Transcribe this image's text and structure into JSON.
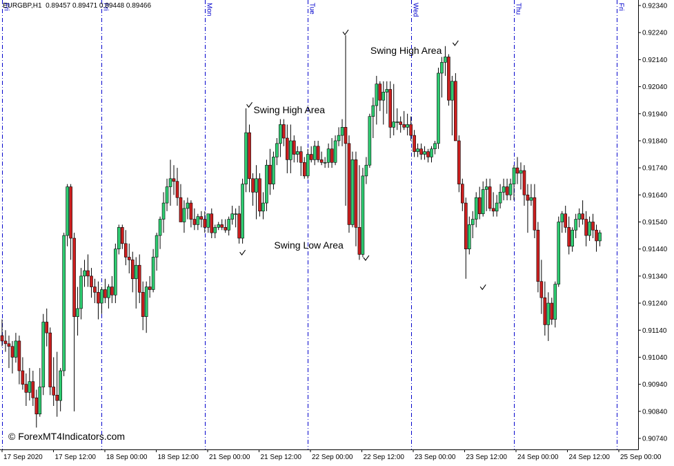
{
  "header": {
    "symbol": "EURGBP,H1",
    "ohlc": "0.89457 0.89471 0.89448 0.89466"
  },
  "watermark": "© ForexMT4Indicators.com",
  "colors": {
    "bull_candle": "#2ecc71",
    "bear_candle": "#cc1f1f",
    "wick": "#000000",
    "separator": "#0000cc",
    "axis": "#000000",
    "background": "#ffffff"
  },
  "chart_data": {
    "type": "candlestick",
    "symbol": "EURGBP",
    "timeframe": "H1",
    "grid": false,
    "y_ticks": [
      "0.92340",
      "0.92240",
      "0.92140",
      "0.92040",
      "0.91940",
      "0.91840",
      "0.91740",
      "0.91640",
      "0.91540",
      "0.91440",
      "0.91340",
      "0.91240",
      "0.91140",
      "0.91040",
      "0.90940",
      "0.90840",
      "0.90740"
    ],
    "ylim": [
      0.907,
      0.9236
    ],
    "x_ticks": [
      "17 Sep 2020",
      "17 Sep 12:00",
      "18 Sep 00:00",
      "18 Sep 12:00",
      "21 Sep 00:00",
      "21 Sep 12:00",
      "22 Sep 00:00",
      "22 Sep 12:00",
      "23 Sep 00:00",
      "23 Sep 12:00",
      "24 Sep 00:00",
      "24 Sep 12:00",
      "25 Sep 00:00"
    ],
    "day_separators": [
      {
        "label": "Fri",
        "index": 0
      },
      {
        "label": "Fri",
        "index": 29
      },
      {
        "label": "Mon",
        "index": 59
      },
      {
        "label": "Tue",
        "index": 89
      },
      {
        "label": "Wed",
        "index": 119
      },
      {
        "label": "Thu",
        "index": 149
      },
      {
        "label": "Fri",
        "index": 179
      }
    ],
    "annotations": [
      {
        "text": "Swing High Area",
        "index": 73,
        "price": 0.91955
      },
      {
        "text": "Swing High Area",
        "index": 107,
        "price": 0.92175
      },
      {
        "text": "Swing Low Area",
        "index": 79,
        "price": 0.91455
      }
    ],
    "marks": [
      {
        "index": 72,
        "price": 0.91972
      },
      {
        "index": 100,
        "price": 0.9224
      },
      {
        "index": 132,
        "price": 0.922
      },
      {
        "index": 70,
        "price": 0.91426
      },
      {
        "index": 106,
        "price": 0.91406
      },
      {
        "index": 140,
        "price": 0.91298
      }
    ],
    "candles": [
      {
        "o": 0.9112,
        "h": 0.9118,
        "l": 0.9108,
        "c": 0.911
      },
      {
        "o": 0.911,
        "h": 0.9114,
        "l": 0.9106,
        "c": 0.9109
      },
      {
        "o": 0.9109,
        "h": 0.9112,
        "l": 0.91,
        "c": 0.9108
      },
      {
        "o": 0.9108,
        "h": 0.911,
        "l": 0.9098,
        "c": 0.9104
      },
      {
        "o": 0.9104,
        "h": 0.9113,
        "l": 0.9102,
        "c": 0.911
      },
      {
        "o": 0.911,
        "h": 0.9112,
        "l": 0.9094,
        "c": 0.9099
      },
      {
        "o": 0.9099,
        "h": 0.9104,
        "l": 0.9092,
        "c": 0.9094
      },
      {
        "o": 0.9094,
        "h": 0.9098,
        "l": 0.9086,
        "c": 0.9091
      },
      {
        "o": 0.9091,
        "h": 0.91,
        "l": 0.9088,
        "c": 0.9095
      },
      {
        "o": 0.9095,
        "h": 0.9099,
        "l": 0.9086,
        "c": 0.9089
      },
      {
        "o": 0.9089,
        "h": 0.9092,
        "l": 0.9078,
        "c": 0.9083
      },
      {
        "o": 0.9083,
        "h": 0.91,
        "l": 0.9082,
        "c": 0.9093
      },
      {
        "o": 0.9093,
        "h": 0.912,
        "l": 0.909,
        "c": 0.9117
      },
      {
        "o": 0.9117,
        "h": 0.9122,
        "l": 0.9108,
        "c": 0.9113
      },
      {
        "o": 0.9113,
        "h": 0.9115,
        "l": 0.909,
        "c": 0.9093
      },
      {
        "o": 0.9093,
        "h": 0.9104,
        "l": 0.9086,
        "c": 0.909
      },
      {
        "o": 0.909,
        "h": 0.9106,
        "l": 0.9082,
        "c": 0.9088
      },
      {
        "o": 0.9088,
        "h": 0.91,
        "l": 0.9084,
        "c": 0.9099
      },
      {
        "o": 0.9099,
        "h": 0.915,
        "l": 0.9097,
        "c": 0.9149
      },
      {
        "o": 0.9149,
        "h": 0.9168,
        "l": 0.9145,
        "c": 0.9167
      },
      {
        "o": 0.9167,
        "h": 0.9168,
        "l": 0.914,
        "c": 0.9148
      },
      {
        "o": 0.9148,
        "h": 0.915,
        "l": 0.9084,
        "c": 0.9119
      },
      {
        "o": 0.9119,
        "h": 0.913,
        "l": 0.9112,
        "c": 0.9122
      },
      {
        "o": 0.9122,
        "h": 0.9137,
        "l": 0.9118,
        "c": 0.9134
      },
      {
        "o": 0.9134,
        "h": 0.914,
        "l": 0.913,
        "c": 0.9136
      },
      {
        "o": 0.9136,
        "h": 0.9142,
        "l": 0.913,
        "c": 0.9134
      },
      {
        "o": 0.9134,
        "h": 0.9137,
        "l": 0.9126,
        "c": 0.913
      },
      {
        "o": 0.913,
        "h": 0.9133,
        "l": 0.9124,
        "c": 0.9128
      },
      {
        "o": 0.9128,
        "h": 0.9132,
        "l": 0.9118,
        "c": 0.9124
      },
      {
        "o": 0.9124,
        "h": 0.913,
        "l": 0.912,
        "c": 0.9129
      },
      {
        "o": 0.9129,
        "h": 0.9133,
        "l": 0.9124,
        "c": 0.9126
      },
      {
        "o": 0.9126,
        "h": 0.9131,
        "l": 0.9122,
        "c": 0.913
      },
      {
        "o": 0.913,
        "h": 0.9134,
        "l": 0.9124,
        "c": 0.9127
      },
      {
        "o": 0.9127,
        "h": 0.9146,
        "l": 0.9124,
        "c": 0.9144
      },
      {
        "o": 0.9144,
        "h": 0.9153,
        "l": 0.9142,
        "c": 0.9152
      },
      {
        "o": 0.9152,
        "h": 0.9153,
        "l": 0.9144,
        "c": 0.9146
      },
      {
        "o": 0.9146,
        "h": 0.9151,
        "l": 0.9138,
        "c": 0.9141
      },
      {
        "o": 0.9141,
        "h": 0.9146,
        "l": 0.9135,
        "c": 0.914
      },
      {
        "o": 0.914,
        "h": 0.9143,
        "l": 0.9128,
        "c": 0.9133
      },
      {
        "o": 0.9133,
        "h": 0.9141,
        "l": 0.9122,
        "c": 0.9138
      },
      {
        "o": 0.9138,
        "h": 0.9142,
        "l": 0.9124,
        "c": 0.9128
      },
      {
        "o": 0.9128,
        "h": 0.9132,
        "l": 0.9114,
        "c": 0.9119
      },
      {
        "o": 0.9119,
        "h": 0.9132,
        "l": 0.9113,
        "c": 0.913
      },
      {
        "o": 0.913,
        "h": 0.9134,
        "l": 0.9126,
        "c": 0.9129
      },
      {
        "o": 0.9129,
        "h": 0.9144,
        "l": 0.9128,
        "c": 0.9141
      },
      {
        "o": 0.9141,
        "h": 0.915,
        "l": 0.9136,
        "c": 0.9149
      },
      {
        "o": 0.9149,
        "h": 0.9156,
        "l": 0.9144,
        "c": 0.9155
      },
      {
        "o": 0.9155,
        "h": 0.9165,
        "l": 0.915,
        "c": 0.9161
      },
      {
        "o": 0.9161,
        "h": 0.917,
        "l": 0.9158,
        "c": 0.9167
      },
      {
        "o": 0.9167,
        "h": 0.9177,
        "l": 0.916,
        "c": 0.917
      },
      {
        "o": 0.917,
        "h": 0.9175,
        "l": 0.9164,
        "c": 0.9169
      },
      {
        "o": 0.9169,
        "h": 0.9174,
        "l": 0.916,
        "c": 0.9163
      },
      {
        "o": 0.9163,
        "h": 0.9168,
        "l": 0.9154,
        "c": 0.9154
      },
      {
        "o": 0.9154,
        "h": 0.9162,
        "l": 0.915,
        "c": 0.9159
      },
      {
        "o": 0.9159,
        "h": 0.9163,
        "l": 0.9155,
        "c": 0.9161
      },
      {
        "o": 0.9161,
        "h": 0.9162,
        "l": 0.9152,
        "c": 0.9155
      },
      {
        "o": 0.9155,
        "h": 0.9159,
        "l": 0.9151,
        "c": 0.9153
      },
      {
        "o": 0.9153,
        "h": 0.9157,
        "l": 0.9151,
        "c": 0.9156
      },
      {
        "o": 0.9156,
        "h": 0.9158,
        "l": 0.9152,
        "c": 0.9155
      },
      {
        "o": 0.9155,
        "h": 0.9158,
        "l": 0.915,
        "c": 0.9152
      },
      {
        "o": 0.9152,
        "h": 0.9156,
        "l": 0.915,
        "c": 0.9157
      },
      {
        "o": 0.9157,
        "h": 0.9159,
        "l": 0.9148,
        "c": 0.915
      },
      {
        "o": 0.915,
        "h": 0.9153,
        "l": 0.9148,
        "c": 0.9152
      },
      {
        "o": 0.9152,
        "h": 0.9154,
        "l": 0.9151,
        "c": 0.9153
      },
      {
        "o": 0.9153,
        "h": 0.9155,
        "l": 0.9151,
        "c": 0.9152
      },
      {
        "o": 0.9152,
        "h": 0.9155,
        "l": 0.915,
        "c": 0.9151
      },
      {
        "o": 0.9151,
        "h": 0.9156,
        "l": 0.9149,
        "c": 0.9155
      },
      {
        "o": 0.9155,
        "h": 0.916,
        "l": 0.9153,
        "c": 0.9157
      },
      {
        "o": 0.9157,
        "h": 0.9159,
        "l": 0.9152,
        "c": 0.9157
      },
      {
        "o": 0.9157,
        "h": 0.916,
        "l": 0.9146,
        "c": 0.9148
      },
      {
        "o": 0.9148,
        "h": 0.917,
        "l": 0.9146,
        "c": 0.9168
      },
      {
        "o": 0.9168,
        "h": 0.9196,
        "l": 0.9165,
        "c": 0.9187
      },
      {
        "o": 0.9187,
        "h": 0.919,
        "l": 0.9165,
        "c": 0.917
      },
      {
        "o": 0.917,
        "h": 0.9172,
        "l": 0.916,
        "c": 0.9165
      },
      {
        "o": 0.9165,
        "h": 0.9175,
        "l": 0.9155,
        "c": 0.917
      },
      {
        "o": 0.917,
        "h": 0.9172,
        "l": 0.9156,
        "c": 0.9158
      },
      {
        "o": 0.9158,
        "h": 0.9165,
        "l": 0.9155,
        "c": 0.9161
      },
      {
        "o": 0.9161,
        "h": 0.9177,
        "l": 0.9158,
        "c": 0.9175
      },
      {
        "o": 0.9175,
        "h": 0.9181,
        "l": 0.9164,
        "c": 0.9168
      },
      {
        "o": 0.9168,
        "h": 0.918,
        "l": 0.9166,
        "c": 0.9178
      },
      {
        "o": 0.9178,
        "h": 0.9185,
        "l": 0.9175,
        "c": 0.9183
      },
      {
        "o": 0.9183,
        "h": 0.9192,
        "l": 0.9178,
        "c": 0.919
      },
      {
        "o": 0.919,
        "h": 0.9192,
        "l": 0.9182,
        "c": 0.9185
      },
      {
        "o": 0.9185,
        "h": 0.919,
        "l": 0.9172,
        "c": 0.9177
      },
      {
        "o": 0.9177,
        "h": 0.919,
        "l": 0.9172,
        "c": 0.9184
      },
      {
        "o": 0.9184,
        "h": 0.9186,
        "l": 0.9176,
        "c": 0.9179
      },
      {
        "o": 0.9179,
        "h": 0.9182,
        "l": 0.9176,
        "c": 0.918
      },
      {
        "o": 0.918,
        "h": 0.9182,
        "l": 0.9171,
        "c": 0.9176
      },
      {
        "o": 0.9176,
        "h": 0.9178,
        "l": 0.917,
        "c": 0.9171
      },
      {
        "o": 0.9171,
        "h": 0.9181,
        "l": 0.917,
        "c": 0.9179
      },
      {
        "o": 0.9179,
        "h": 0.9182,
        "l": 0.9176,
        "c": 0.9177
      },
      {
        "o": 0.9177,
        "h": 0.9184,
        "l": 0.9175,
        "c": 0.9182
      },
      {
        "o": 0.9182,
        "h": 0.9184,
        "l": 0.9176,
        "c": 0.9177
      },
      {
        "o": 0.9177,
        "h": 0.918,
        "l": 0.9175,
        "c": 0.9176
      },
      {
        "o": 0.9176,
        "h": 0.9178,
        "l": 0.9174,
        "c": 0.9176
      },
      {
        "o": 0.9176,
        "h": 0.9183,
        "l": 0.9174,
        "c": 0.9181
      },
      {
        "o": 0.9181,
        "h": 0.9185,
        "l": 0.9174,
        "c": 0.9176
      },
      {
        "o": 0.9176,
        "h": 0.9186,
        "l": 0.9175,
        "c": 0.9184
      },
      {
        "o": 0.9184,
        "h": 0.9189,
        "l": 0.9182,
        "c": 0.9186
      },
      {
        "o": 0.9186,
        "h": 0.9192,
        "l": 0.9182,
        "c": 0.9189
      },
      {
        "o": 0.9189,
        "h": 0.9223,
        "l": 0.916,
        "c": 0.9183
      },
      {
        "o": 0.9183,
        "h": 0.9186,
        "l": 0.915,
        "c": 0.9153
      },
      {
        "o": 0.9153,
        "h": 0.918,
        "l": 0.9152,
        "c": 0.9177
      },
      {
        "o": 0.9177,
        "h": 0.918,
        "l": 0.9145,
        "c": 0.9152
      },
      {
        "o": 0.9152,
        "h": 0.9175,
        "l": 0.914,
        "c": 0.9142
      },
      {
        "o": 0.9142,
        "h": 0.9174,
        "l": 0.9141,
        "c": 0.9171
      },
      {
        "o": 0.9171,
        "h": 0.9178,
        "l": 0.9168,
        "c": 0.9175
      },
      {
        "o": 0.9175,
        "h": 0.9194,
        "l": 0.9174,
        "c": 0.9193
      },
      {
        "o": 0.9193,
        "h": 0.92,
        "l": 0.9185,
        "c": 0.9197
      },
      {
        "o": 0.9197,
        "h": 0.9208,
        "l": 0.919,
        "c": 0.9205
      },
      {
        "o": 0.9205,
        "h": 0.9206,
        "l": 0.9195,
        "c": 0.9199
      },
      {
        "o": 0.9199,
        "h": 0.9206,
        "l": 0.919,
        "c": 0.9202
      },
      {
        "o": 0.9202,
        "h": 0.9206,
        "l": 0.9194,
        "c": 0.9203
      },
      {
        "o": 0.9203,
        "h": 0.9206,
        "l": 0.9185,
        "c": 0.9189
      },
      {
        "o": 0.9189,
        "h": 0.9205,
        "l": 0.9186,
        "c": 0.9191
      },
      {
        "o": 0.9191,
        "h": 0.9196,
        "l": 0.9188,
        "c": 0.9191
      },
      {
        "o": 0.9191,
        "h": 0.9193,
        "l": 0.9187,
        "c": 0.919
      },
      {
        "o": 0.919,
        "h": 0.9195,
        "l": 0.9188,
        "c": 0.9189
      },
      {
        "o": 0.9189,
        "h": 0.9194,
        "l": 0.9186,
        "c": 0.919
      },
      {
        "o": 0.919,
        "h": 0.9193,
        "l": 0.9184,
        "c": 0.9186
      },
      {
        "o": 0.9186,
        "h": 0.9188,
        "l": 0.9178,
        "c": 0.918
      },
      {
        "o": 0.918,
        "h": 0.9183,
        "l": 0.9178,
        "c": 0.9181
      },
      {
        "o": 0.9181,
        "h": 0.9183,
        "l": 0.9177,
        "c": 0.9179
      },
      {
        "o": 0.9179,
        "h": 0.9182,
        "l": 0.9177,
        "c": 0.918
      },
      {
        "o": 0.918,
        "h": 0.9181,
        "l": 0.9176,
        "c": 0.9178
      },
      {
        "o": 0.9178,
        "h": 0.9182,
        "l": 0.9176,
        "c": 0.9181
      },
      {
        "o": 0.9181,
        "h": 0.9184,
        "l": 0.9179,
        "c": 0.9183
      },
      {
        "o": 0.9183,
        "h": 0.9211,
        "l": 0.9181,
        "c": 0.9209
      },
      {
        "o": 0.9209,
        "h": 0.9215,
        "l": 0.92,
        "c": 0.9213
      },
      {
        "o": 0.9213,
        "h": 0.9219,
        "l": 0.9208,
        "c": 0.9215
      },
      {
        "o": 0.9215,
        "h": 0.9216,
        "l": 0.9197,
        "c": 0.9199
      },
      {
        "o": 0.9199,
        "h": 0.9208,
        "l": 0.9186,
        "c": 0.9206
      },
      {
        "o": 0.9206,
        "h": 0.9209,
        "l": 0.9184,
        "c": 0.9184
      },
      {
        "o": 0.9184,
        "h": 0.9186,
        "l": 0.9165,
        "c": 0.9168
      },
      {
        "o": 0.9168,
        "h": 0.917,
        "l": 0.9158,
        "c": 0.9161
      },
      {
        "o": 0.9161,
        "h": 0.9163,
        "l": 0.9133,
        "c": 0.9144
      },
      {
        "o": 0.9144,
        "h": 0.9156,
        "l": 0.9142,
        "c": 0.9153
      },
      {
        "o": 0.9153,
        "h": 0.9158,
        "l": 0.9148,
        "c": 0.9155
      },
      {
        "o": 0.9155,
        "h": 0.9165,
        "l": 0.9152,
        "c": 0.9163
      },
      {
        "o": 0.9163,
        "h": 0.9167,
        "l": 0.9155,
        "c": 0.9157
      },
      {
        "o": 0.9157,
        "h": 0.9169,
        "l": 0.9156,
        "c": 0.9166
      },
      {
        "o": 0.9166,
        "h": 0.917,
        "l": 0.9158,
        "c": 0.9167
      },
      {
        "o": 0.9167,
        "h": 0.917,
        "l": 0.9158,
        "c": 0.9159
      },
      {
        "o": 0.9159,
        "h": 0.9165,
        "l": 0.9156,
        "c": 0.9158
      },
      {
        "o": 0.9158,
        "h": 0.9164,
        "l": 0.9156,
        "c": 0.9161
      },
      {
        "o": 0.9161,
        "h": 0.9168,
        "l": 0.9159,
        "c": 0.9165
      },
      {
        "o": 0.9165,
        "h": 0.917,
        "l": 0.9162,
        "c": 0.9167
      },
      {
        "o": 0.9167,
        "h": 0.917,
        "l": 0.9162,
        "c": 0.9164
      },
      {
        "o": 0.9164,
        "h": 0.917,
        "l": 0.9162,
        "c": 0.9168
      },
      {
        "o": 0.9168,
        "h": 0.9175,
        "l": 0.9162,
        "c": 0.9174
      },
      {
        "o": 0.9174,
        "h": 0.9178,
        "l": 0.9168,
        "c": 0.9172
      },
      {
        "o": 0.9172,
        "h": 0.9176,
        "l": 0.9166,
        "c": 0.9173
      },
      {
        "o": 0.9173,
        "h": 0.9175,
        "l": 0.916,
        "c": 0.9164
      },
      {
        "o": 0.9164,
        "h": 0.9168,
        "l": 0.915,
        "c": 0.9162
      },
      {
        "o": 0.9162,
        "h": 0.9168,
        "l": 0.916,
        "c": 0.9163
      },
      {
        "o": 0.9163,
        "h": 0.9168,
        "l": 0.9148,
        "c": 0.9151
      },
      {
        "o": 0.9151,
        "h": 0.9154,
        "l": 0.9128,
        "c": 0.9132
      },
      {
        "o": 0.9132,
        "h": 0.914,
        "l": 0.912,
        "c": 0.9126
      },
      {
        "o": 0.9126,
        "h": 0.9132,
        "l": 0.9112,
        "c": 0.9116
      },
      {
        "o": 0.9116,
        "h": 0.9128,
        "l": 0.911,
        "c": 0.9124
      },
      {
        "o": 0.9124,
        "h": 0.9126,
        "l": 0.9116,
        "c": 0.9118
      },
      {
        "o": 0.9118,
        "h": 0.9132,
        "l": 0.9115,
        "c": 0.9131
      },
      {
        "o": 0.9131,
        "h": 0.9156,
        "l": 0.913,
        "c": 0.9154
      },
      {
        "o": 0.9154,
        "h": 0.9158,
        "l": 0.915,
        "c": 0.9157
      },
      {
        "o": 0.9157,
        "h": 0.916,
        "l": 0.915,
        "c": 0.9152
      },
      {
        "o": 0.9152,
        "h": 0.9156,
        "l": 0.9142,
        "c": 0.9145
      },
      {
        "o": 0.9145,
        "h": 0.9152,
        "l": 0.9143,
        "c": 0.9151
      },
      {
        "o": 0.9151,
        "h": 0.9157,
        "l": 0.9148,
        "c": 0.9155
      },
      {
        "o": 0.9155,
        "h": 0.9159,
        "l": 0.9152,
        "c": 0.9157
      },
      {
        "o": 0.9157,
        "h": 0.9162,
        "l": 0.9153,
        "c": 0.9155
      },
      {
        "o": 0.9155,
        "h": 0.9158,
        "l": 0.9145,
        "c": 0.9149
      },
      {
        "o": 0.9149,
        "h": 0.9156,
        "l": 0.9147,
        "c": 0.9154
      },
      {
        "o": 0.9154,
        "h": 0.9157,
        "l": 0.9148,
        "c": 0.9151
      },
      {
        "o": 0.9151,
        "h": 0.9153,
        "l": 0.9143,
        "c": 0.9147
      },
      {
        "o": 0.9147,
        "h": 0.9151,
        "l": 0.9145,
        "c": 0.915
      }
    ]
  }
}
